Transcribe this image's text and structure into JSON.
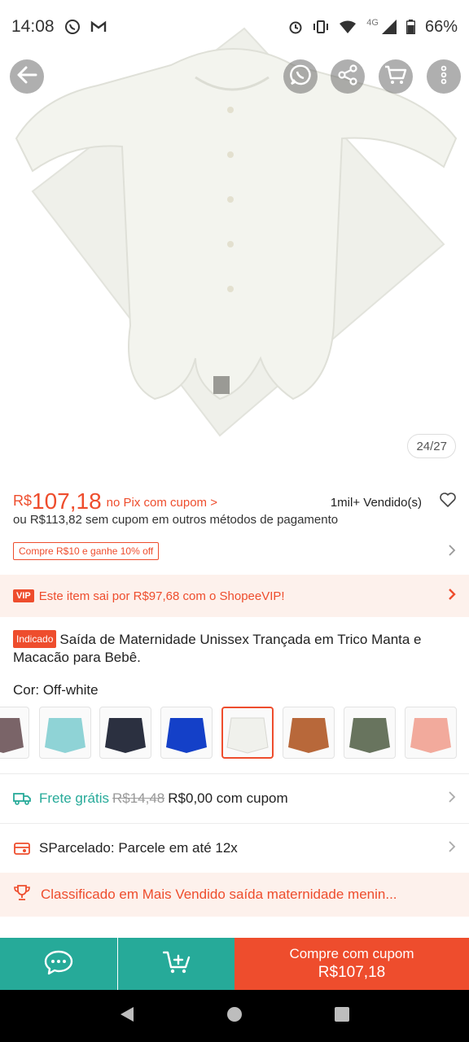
{
  "status_bar": {
    "time": "14:08",
    "network": "4G",
    "battery": "66%"
  },
  "image": {
    "counter": "24/27"
  },
  "price": {
    "currency": "R$",
    "value": "107,18",
    "note": "no Pix com cupom >",
    "sold": "1mil+ Vendido(s)",
    "alt": "ou R$113,82 sem cupom em outros métodos de pagamento"
  },
  "coupon": {
    "tag": "Compre R$10 e ganhe 10% off"
  },
  "vip": {
    "badge": "VIP",
    "text": "Este item sai por R$97,68 com o ShopeeVIP!"
  },
  "product": {
    "badge": "Indicado",
    "title": "Saída de Maternidade Unissex Trançada em Trico Manta e Macacão para Bebê."
  },
  "variant": {
    "label": "Cor: Off-white",
    "swatches": [
      {
        "name": "mauve",
        "color": "#7a6468"
      },
      {
        "name": "aqua",
        "color": "#8fd3d6"
      },
      {
        "name": "navy",
        "color": "#2b3040"
      },
      {
        "name": "royal-blue",
        "color": "#1440c8"
      },
      {
        "name": "off-white",
        "color": "#f0f1ec"
      },
      {
        "name": "caramel",
        "color": "#b8683a"
      },
      {
        "name": "olive",
        "color": "#68745e"
      },
      {
        "name": "pink",
        "color": "#f2aa9c"
      }
    ]
  },
  "shipping": {
    "label": "Frete grátis",
    "old_price": "R$14,48",
    "new_price": "R$0,00 com cupom"
  },
  "installments": {
    "text": "SParcelado: Parcele em até 12x"
  },
  "ranking": {
    "text": "Classificado em Mais Vendido saída maternidade menin..."
  },
  "actions": {
    "buy_line1": "Compre com cupom",
    "buy_line2": "R$107,18"
  },
  "colors": {
    "brand": "#ee4d2d",
    "teal": "#26aa99"
  }
}
